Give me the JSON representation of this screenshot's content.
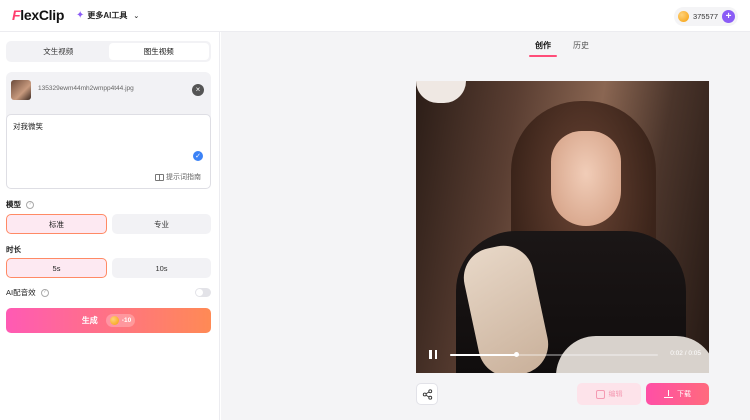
{
  "header": {
    "logo_prefix": "F",
    "logo_rest": "lexClip",
    "more_ai_tools": "更多AI工具",
    "credits": "375577"
  },
  "left_panel": {
    "tabs": [
      {
        "label": "文生视频",
        "active": false
      },
      {
        "label": "图生视频",
        "active": true
      }
    ],
    "uploaded_file": "135329ewm44mh2wmpp4t44.jpg",
    "prompt_text": "对我微笑",
    "prompt_guide": "提示词指南",
    "model": {
      "label": "模型",
      "options": [
        {
          "label": "标准",
          "selected": true
        },
        {
          "label": "专业",
          "selected": false
        }
      ]
    },
    "duration": {
      "label": "时长",
      "options": [
        {
          "label": "5s",
          "selected": true
        },
        {
          "label": "10s",
          "selected": false
        }
      ]
    },
    "ai_sound": {
      "label": "AI配音效",
      "enabled": false
    },
    "generate": {
      "label": "生成",
      "cost": "-10"
    }
  },
  "right_panel": {
    "tabs": [
      {
        "label": "创作",
        "active": true
      },
      {
        "label": "历史",
        "active": false
      }
    ],
    "player": {
      "time": "0:02 / 0:05",
      "progress": 0.32
    },
    "edit_label": "编辑",
    "download_label": "下载"
  },
  "colors": {
    "accent_pink": "#ff4d79",
    "purple": "#8b5cf6",
    "gradient_start": "#ff5ab4",
    "gradient_end": "#ff8a55"
  }
}
